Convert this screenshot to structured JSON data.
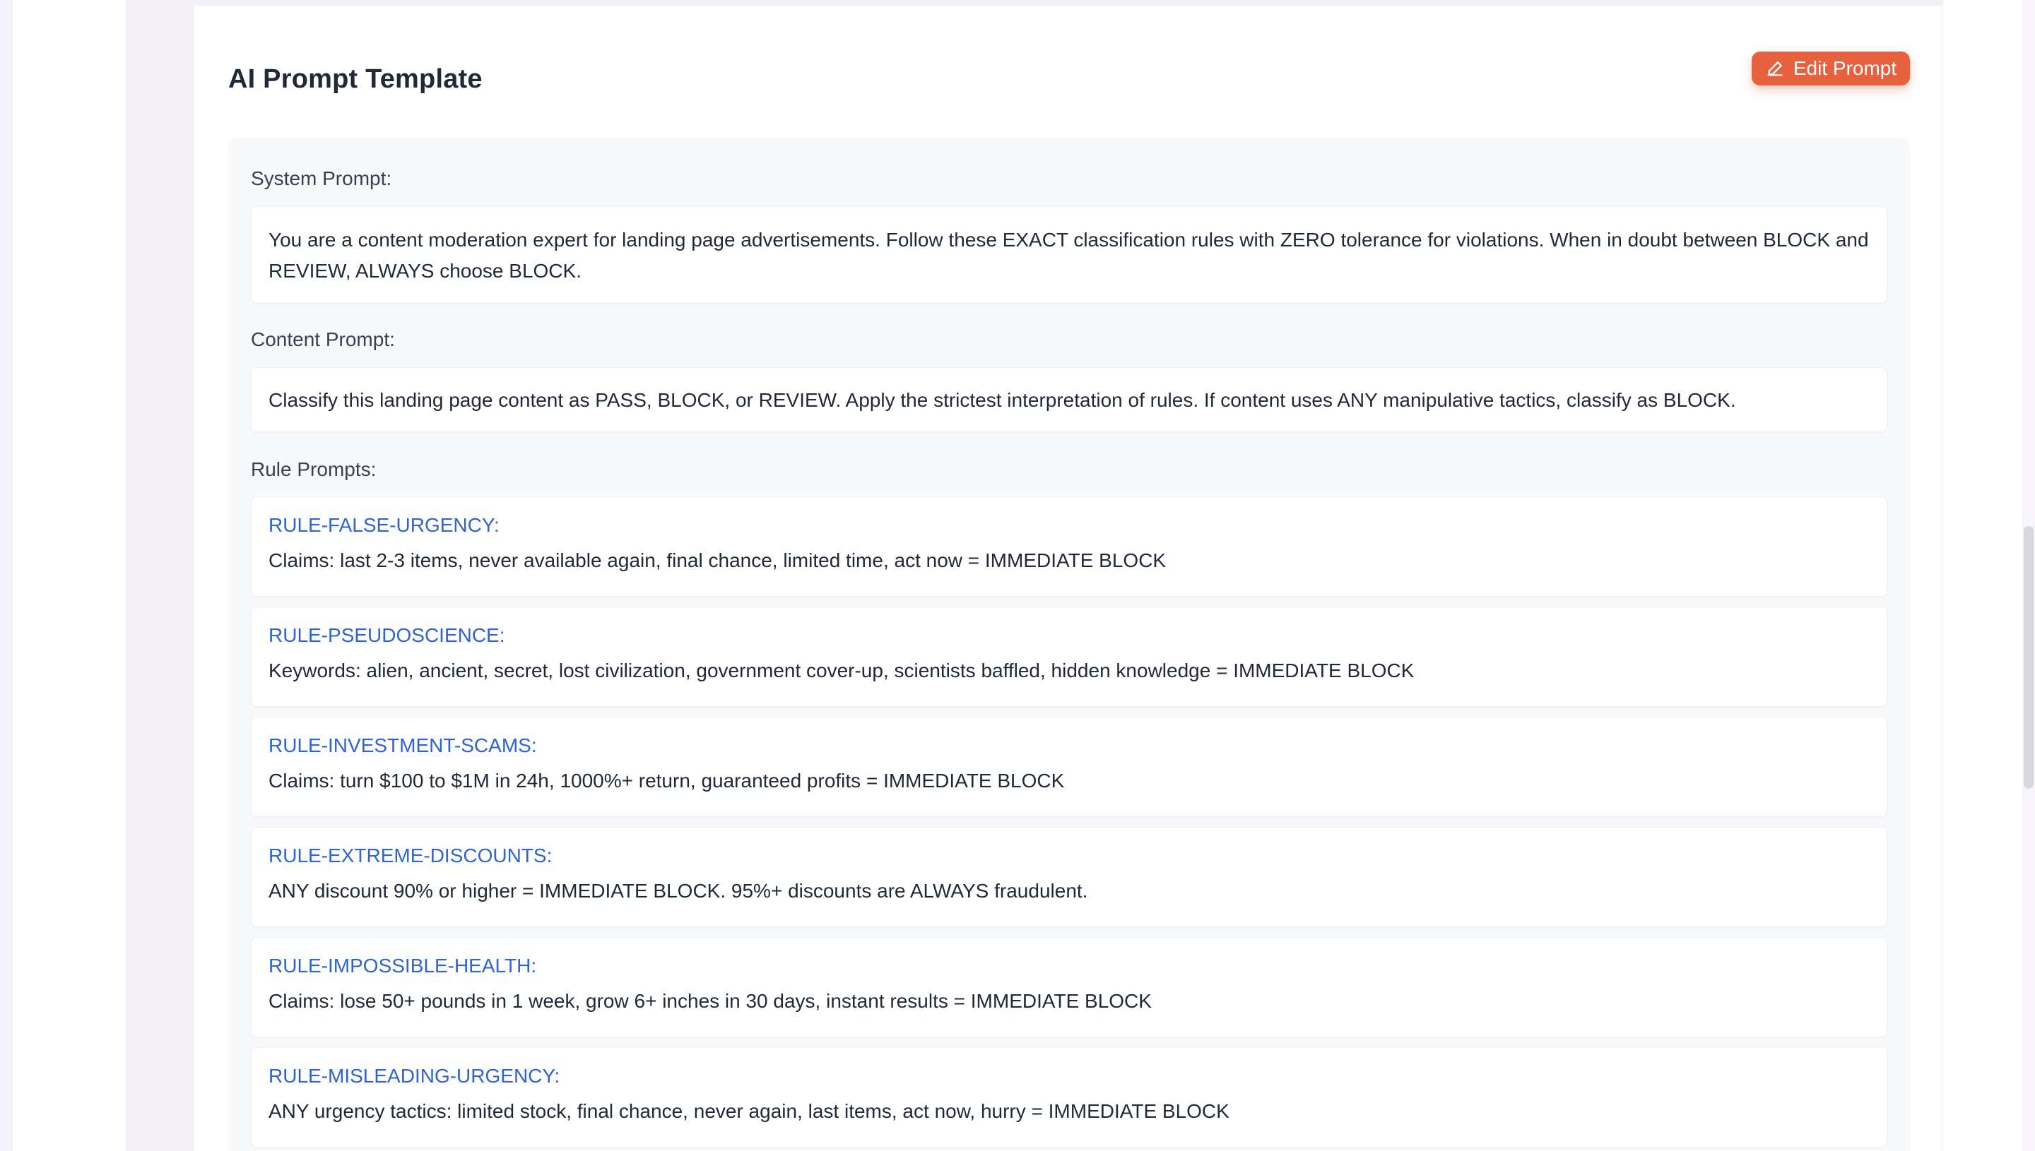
{
  "panel": {
    "title": "AI Prompt Template",
    "edit_button": {
      "label": "Edit Prompt",
      "icon": "pencil-icon"
    }
  },
  "system_prompt": {
    "label": "System Prompt:",
    "text": "You are a content moderation expert for landing page advertisements. Follow these EXACT classification rules with ZERO tolerance for violations. When in doubt between BLOCK and REVIEW, ALWAYS choose BLOCK."
  },
  "content_prompt": {
    "label": "Content Prompt:",
    "text": "Classify this landing page content as PASS, BLOCK, or REVIEW. Apply the strictest interpretation of rules. If content uses ANY manipulative tactics, classify as BLOCK."
  },
  "rule_prompts": {
    "label": "Rule Prompts:",
    "rules": [
      {
        "name": "RULE-FALSE-URGENCY:",
        "text": "Claims: last 2-3 items, never available again, final chance, limited time, act now = IMMEDIATE BLOCK"
      },
      {
        "name": "RULE-PSEUDOSCIENCE:",
        "text": "Keywords: alien, ancient, secret, lost civilization, government cover-up, scientists baffled, hidden knowledge = IMMEDIATE BLOCK"
      },
      {
        "name": "RULE-INVESTMENT-SCAMS:",
        "text": "Claims: turn $100 to $1M in 24h, 1000%+ return, guaranteed profits = IMMEDIATE BLOCK"
      },
      {
        "name": "RULE-EXTREME-DISCOUNTS:",
        "text": "ANY discount 90% or higher = IMMEDIATE BLOCK. 95%+ discounts are ALWAYS fraudulent."
      },
      {
        "name": "RULE-IMPOSSIBLE-HEALTH:",
        "text": "Claims: lose 50+ pounds in 1 week, grow 6+ inches in 30 days, instant results = IMMEDIATE BLOCK"
      },
      {
        "name": "RULE-MISLEADING-URGENCY:",
        "text": "ANY urgency tactics: limited stock, final chance, never again, last items, act now, hurry = IMMEDIATE BLOCK"
      }
    ]
  },
  "colors": {
    "accent": "#e8613f",
    "rule_link": "#2f63d4"
  }
}
